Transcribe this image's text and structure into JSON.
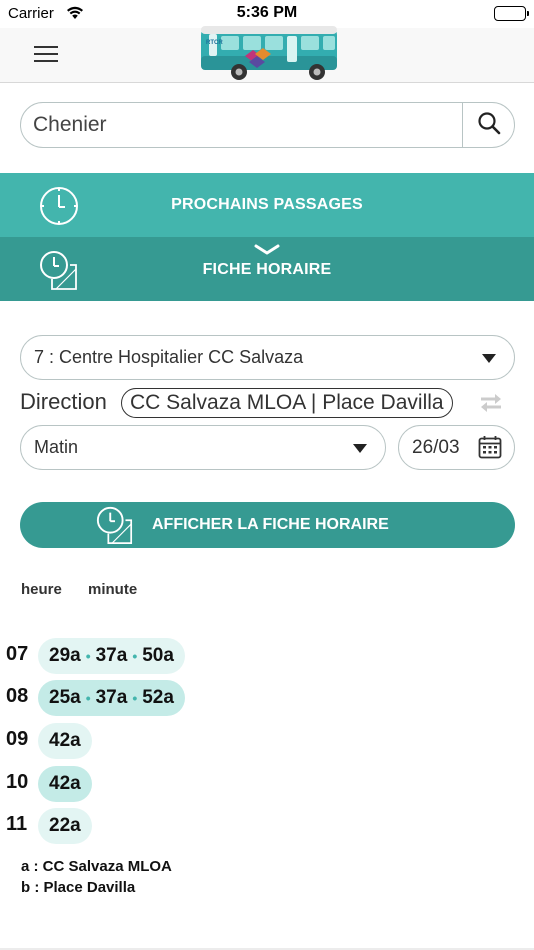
{
  "status_bar": {
    "carrier": "Carrier",
    "time": "5:36 PM",
    "icons": [
      "wifi-icon",
      "battery-icon"
    ]
  },
  "nav": {
    "menu_icon": "hamburger-menu-icon",
    "logo": "bus-logo",
    "logo_text": "RTCR"
  },
  "search": {
    "value": "Chenier",
    "icon": "search-icon"
  },
  "tabs": {
    "next_departures_label": "PROCHAINS PASSAGES",
    "timetable_label": "FICHE HORAIRE"
  },
  "form": {
    "line_value": "7 : Centre Hospitalier CC Salvaza",
    "direction_label": "Direction",
    "direction_value": "CC Salvaza  MLOA | Place Davilla",
    "period_value": "Matin",
    "date_value": "26/03",
    "show_button_label": "AFFICHER LA FICHE HORAIRE"
  },
  "timetable": {
    "header_hour": "heure",
    "header_minute": "minute",
    "rows": [
      {
        "hour": "07",
        "minutes": [
          "29a",
          "37a",
          "50a"
        ]
      },
      {
        "hour": "08",
        "minutes": [
          "25a",
          "37a",
          "52a"
        ]
      },
      {
        "hour": "09",
        "minutes": [
          "42a"
        ]
      },
      {
        "hour": "10",
        "minutes": [
          "42a"
        ]
      },
      {
        "hour": "11",
        "minutes": [
          "22a"
        ]
      }
    ],
    "legend": [
      "a : CC Salvaza  MLOA",
      "b : Place Davilla"
    ]
  },
  "colors": {
    "teal_light": "#43b5ad",
    "teal_dark": "#369a92",
    "pill_light": "#e3f5f3",
    "pill_dark": "#c4ebe7"
  }
}
